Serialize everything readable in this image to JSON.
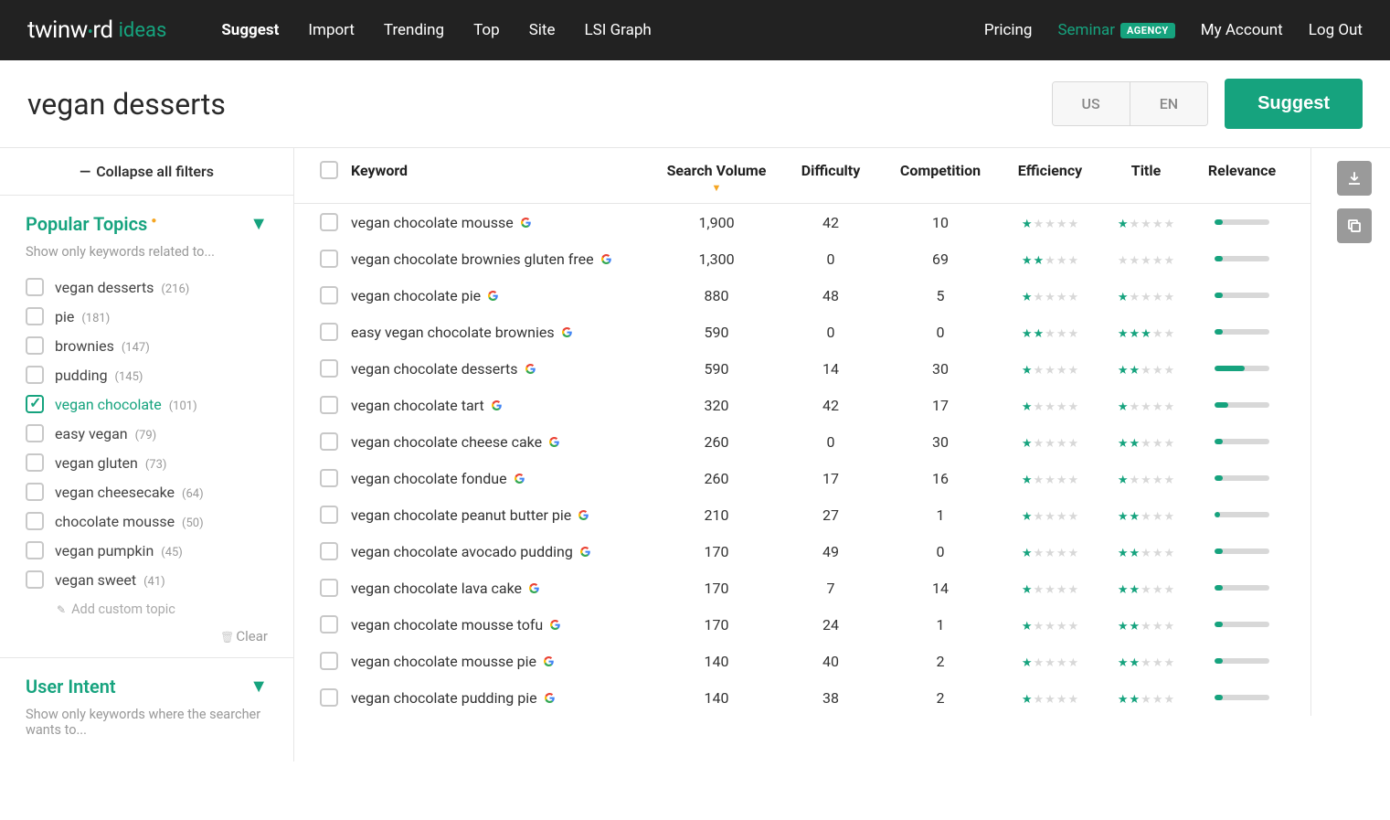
{
  "header": {
    "logo_main1": "twinw",
    "logo_main2": "rd",
    "logo_sub": "ideas",
    "nav": [
      "Suggest",
      "Import",
      "Trending",
      "Top",
      "Site",
      "LSI Graph"
    ],
    "nav_active": "Suggest",
    "nav_right": {
      "pricing": "Pricing",
      "seminar": "Seminar",
      "agency_badge": "AGENCY",
      "account": "My Account",
      "logout": "Log Out"
    }
  },
  "search": {
    "query": "vegan desserts",
    "region1": "US",
    "region2": "EN",
    "button": "Suggest"
  },
  "sidebar": {
    "collapse": "Collapse all filters",
    "popular": {
      "title": "Popular Topics",
      "hint": "Show only keywords related to...",
      "topics": [
        {
          "label": "vegan desserts",
          "count": "(216)",
          "checked": false
        },
        {
          "label": "pie",
          "count": "(181)",
          "checked": false
        },
        {
          "label": "brownies",
          "count": "(147)",
          "checked": false
        },
        {
          "label": "pudding",
          "count": "(145)",
          "checked": false
        },
        {
          "label": "vegan chocolate",
          "count": "(101)",
          "checked": true
        },
        {
          "label": "easy vegan",
          "count": "(79)",
          "checked": false
        },
        {
          "label": "vegan gluten",
          "count": "(73)",
          "checked": false
        },
        {
          "label": "vegan cheesecake",
          "count": "(64)",
          "checked": false
        },
        {
          "label": "chocolate mousse",
          "count": "(50)",
          "checked": false
        },
        {
          "label": "vegan pumpkin",
          "count": "(45)",
          "checked": false
        },
        {
          "label": "vegan sweet",
          "count": "(41)",
          "checked": false
        }
      ],
      "add": "Add custom topic",
      "clear": "Clear"
    },
    "intent": {
      "title": "User Intent",
      "hint": "Show only keywords where the searcher wants to..."
    }
  },
  "table": {
    "headers": {
      "keyword": "Keyword",
      "search_volume": "Search Volume",
      "difficulty": "Difficulty",
      "competition": "Competition",
      "efficiency": "Efficiency",
      "title": "Title",
      "relevance": "Relevance"
    },
    "rows": [
      {
        "kw": "vegan chocolate mousse",
        "sv": "1,900",
        "diff": "42",
        "comp": "10",
        "eff": 1,
        "title": 1,
        "rel": 15
      },
      {
        "kw": "vegan chocolate brownies gluten free",
        "sv": "1,300",
        "diff": "0",
        "comp": "69",
        "eff": 2,
        "title": 0,
        "rel": 15
      },
      {
        "kw": "vegan chocolate pie",
        "sv": "880",
        "diff": "48",
        "comp": "5",
        "eff": 1,
        "title": 1,
        "rel": 15
      },
      {
        "kw": "easy vegan chocolate brownies",
        "sv": "590",
        "diff": "0",
        "comp": "0",
        "eff": 2,
        "title": 3,
        "rel": 15
      },
      {
        "kw": "vegan chocolate desserts",
        "sv": "590",
        "diff": "14",
        "comp": "30",
        "eff": 1,
        "title": 2,
        "rel": 55
      },
      {
        "kw": "vegan chocolate tart",
        "sv": "320",
        "diff": "42",
        "comp": "17",
        "eff": 1,
        "title": 1,
        "rel": 25
      },
      {
        "kw": "vegan chocolate cheese cake",
        "sv": "260",
        "diff": "0",
        "comp": "30",
        "eff": 1,
        "title": 2,
        "rel": 15
      },
      {
        "kw": "vegan chocolate fondue",
        "sv": "260",
        "diff": "17",
        "comp": "16",
        "eff": 1,
        "title": 1,
        "rel": 15
      },
      {
        "kw": "vegan chocolate peanut butter pie",
        "sv": "210",
        "diff": "27",
        "comp": "1",
        "eff": 1,
        "title": 2,
        "rel": 10
      },
      {
        "kw": "vegan chocolate avocado pudding",
        "sv": "170",
        "diff": "49",
        "comp": "0",
        "eff": 1,
        "title": 2,
        "rel": 15
      },
      {
        "kw": "vegan chocolate lava cake",
        "sv": "170",
        "diff": "7",
        "comp": "14",
        "eff": 1,
        "title": 2,
        "rel": 15
      },
      {
        "kw": "vegan chocolate mousse tofu",
        "sv": "170",
        "diff": "24",
        "comp": "1",
        "eff": 1,
        "title": 2,
        "rel": 15
      },
      {
        "kw": "vegan chocolate mousse pie",
        "sv": "140",
        "diff": "40",
        "comp": "2",
        "eff": 1,
        "title": 2,
        "rel": 15
      },
      {
        "kw": "vegan chocolate pudding pie",
        "sv": "140",
        "diff": "38",
        "comp": "2",
        "eff": 1,
        "title": 2,
        "rel": 15
      }
    ]
  }
}
